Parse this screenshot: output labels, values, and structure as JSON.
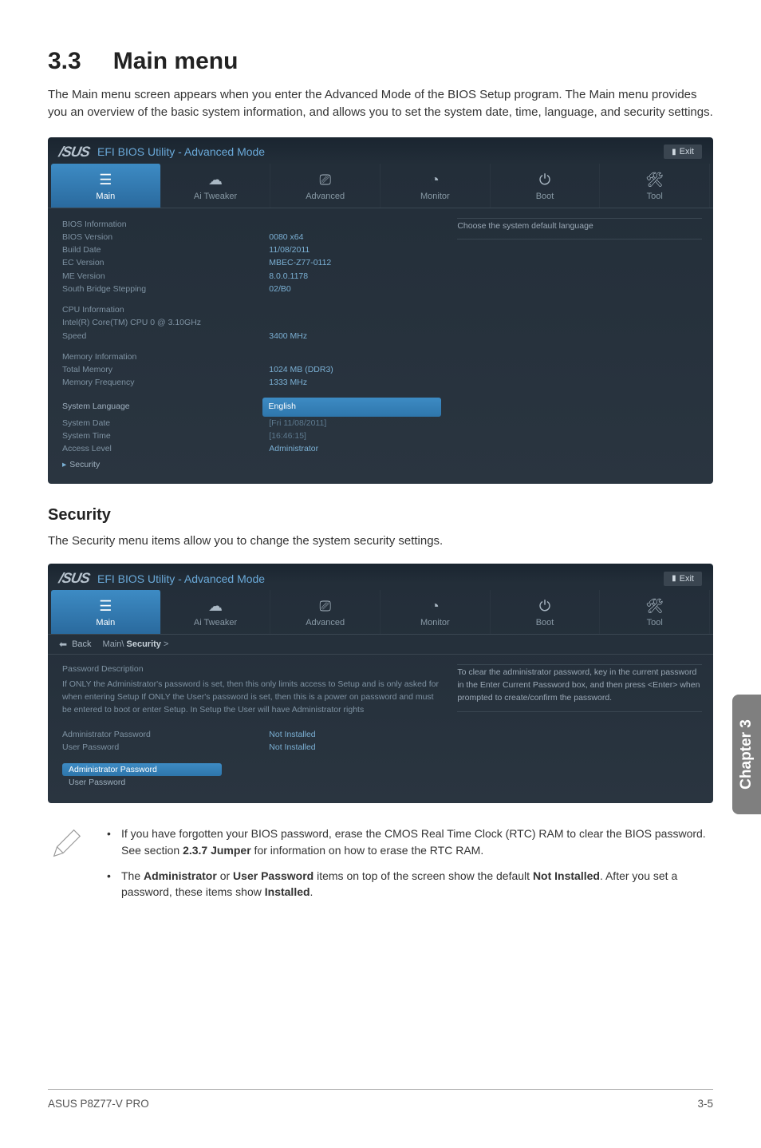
{
  "section_number": "3.3",
  "section_title": "Main menu",
  "intro_text": "The Main menu screen appears when you enter the Advanced Mode of the BIOS Setup program. The Main menu provides you an overview of the basic system information, and allows you to set the system date, time, language, and security settings.",
  "bios": {
    "brand": "/SUS",
    "title": "EFI BIOS Utility - Advanced Mode",
    "exit": "Exit",
    "tabs": {
      "main": "Main",
      "tweaker": "Ai Tweaker",
      "advanced": "Advanced",
      "monitor": "Monitor",
      "boot": "Boot",
      "tool": "Tool"
    }
  },
  "bios1": {
    "help": "Choose the system default language",
    "groups": {
      "bios_info_hdr": "BIOS Information",
      "bios_version_lab": "BIOS Version",
      "bios_version_val": "0080 x64",
      "build_date_lab": "Build Date",
      "build_date_val": "11/08/2011",
      "ec_lab": "EC Version",
      "ec_val": "MBEC-Z77-0112",
      "me_lab": "ME Version",
      "me_val": "8.0.0.1178",
      "sbs_lab": "South Bridge Stepping",
      "sbs_val": "02/B0",
      "cpu_hdr": "CPU Information",
      "cpu_name": "Intel(R) Core(TM) CPU 0 @ 3.10GHz",
      "speed_lab": "Speed",
      "speed_val": "3400 MHz",
      "mem_hdr": "Memory Information",
      "total_lab": "Total Memory",
      "total_val": "1024 MB (DDR3)",
      "freq_lab": "Memory Frequency",
      "freq_val": "1333 MHz",
      "lang_lab": "System Language",
      "lang_val": "English",
      "date_lab": "System Date",
      "date_val": "[Fri 11/08/2011]",
      "time_lab": "System Time",
      "time_val": "[16:46:15]",
      "access_lab": "Access Level",
      "access_val": "Administrator",
      "security_submenu": "Security"
    }
  },
  "security_heading": "Security",
  "security_para": "The Security menu items allow you to change the system security settings.",
  "bios2": {
    "back": "Back",
    "crumb_root": "Main\\",
    "crumb_cur": "Security",
    "crumb_arrow": " >",
    "desc_hdr": "Password Description",
    "desc_body": "If ONLY the Administrator's password is set, then this only limits access to Setup and is only asked for when entering Setup If ONLY the User's password is set, then this is a power on password and must be entered to boot or enter Setup. In Setup the User will have Administrator rights",
    "admin_lab": "Administrator Password",
    "admin_val": "Not Installed",
    "user_lab": "User Password",
    "user_val": "Not Installed",
    "admin_btn": "Administrator Password",
    "user_btn": "User Password",
    "help1": "To clear the administrator password, key in the current password in the Enter Current Password box, and then press <Enter> when prompted to create/confirm the password."
  },
  "notes": {
    "n1a": "If you have forgotten your BIOS password, erase the CMOS Real Time Clock (RTC) RAM to clear the BIOS password. See section ",
    "n1b": "2.3.7 Jumper",
    "n1c": " for information on how to erase the RTC RAM.",
    "n2a": "The ",
    "n2b": "Administrator",
    "n2c": " or ",
    "n2d": "User Password",
    "n2e": " items on top of the screen show the default ",
    "n2f": "Not Installed",
    "n2g": ". After you set a password, these items show ",
    "n2h": "Installed",
    "n2i": "."
  },
  "footer": {
    "left": "ASUS P8Z77-V PRO",
    "right": "3-5"
  },
  "sidebar": "Chapter 3"
}
